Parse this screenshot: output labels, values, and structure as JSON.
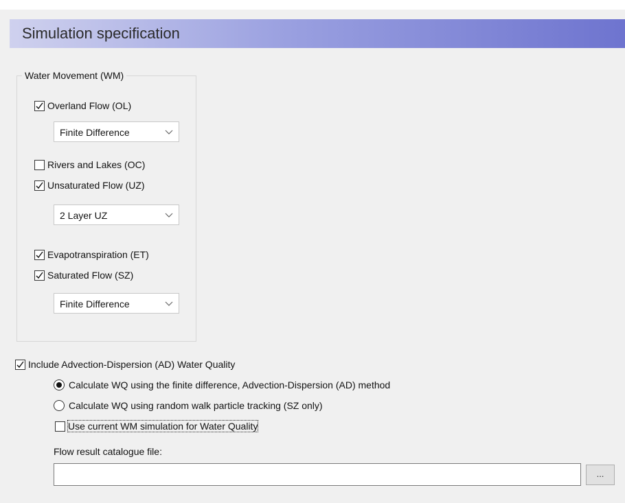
{
  "header": {
    "title": "Simulation specification"
  },
  "water_movement": {
    "legend": "Water Movement (WM)",
    "overland_flow": {
      "label": "Overland Flow (OL)",
      "checked": true,
      "method": "Finite Difference"
    },
    "rivers_lakes": {
      "label": "Rivers and Lakes (OC)",
      "checked": false
    },
    "unsaturated_flow": {
      "label": "Unsaturated Flow (UZ)",
      "checked": true,
      "method": "2 Layer UZ"
    },
    "evapotranspiration": {
      "label": "Evapotranspiration (ET)",
      "checked": true
    },
    "saturated_flow": {
      "label": "Saturated Flow (SZ)",
      "checked": true,
      "method": "Finite Difference"
    }
  },
  "water_quality": {
    "include": {
      "label": "Include Advection-Dispersion (AD) Water Quality",
      "checked": true
    },
    "option_ad": {
      "label": "Calculate WQ using the finite difference, Advection-Dispersion (AD) method",
      "selected": true
    },
    "option_rw": {
      "label": "Calculate WQ using random walk particle tracking (SZ only)",
      "selected": false
    },
    "use_current": {
      "label": "Use current WM simulation for Water Quality",
      "checked": false
    },
    "flow_file": {
      "label": "Flow result catalogue file:",
      "value": ""
    },
    "browse_label": "..."
  }
}
